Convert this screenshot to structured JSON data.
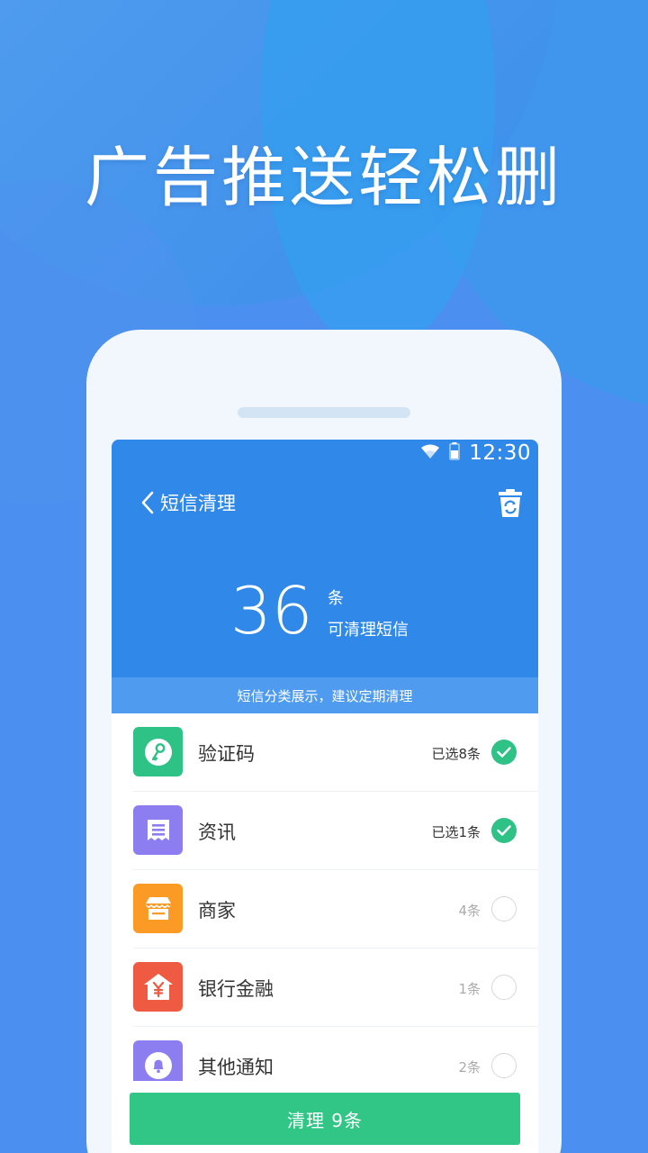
{
  "headline": "广告推送轻松删",
  "status": {
    "time": "12:30"
  },
  "appbar": {
    "title": "短信清理"
  },
  "summary": {
    "count": "36",
    "unit": "条",
    "subtitle": "可清理短信"
  },
  "tip": "短信分类展示，建议定期清理",
  "categories": [
    {
      "label": "验证码",
      "count": "已选8条",
      "selected": true,
      "icon": "key-icon",
      "color": "#2fc286"
    },
    {
      "label": "资讯",
      "count": "已选1条",
      "selected": true,
      "icon": "receipt-icon",
      "color": "#8c7ef0"
    },
    {
      "label": "商家",
      "count": "4条",
      "selected": false,
      "icon": "store-icon",
      "color": "#fb9b26"
    },
    {
      "label": "银行金融",
      "count": "1条",
      "selected": false,
      "icon": "bank-icon",
      "color": "#ef5b42"
    },
    {
      "label": "其他通知",
      "count": "2条",
      "selected": false,
      "icon": "bell-icon",
      "color": "#8c7ef0"
    }
  ],
  "action": {
    "clean_label": "清理 9条"
  },
  "colors": {
    "background": "#4b8ff0",
    "hero": "#3089e8",
    "accent_green": "#32c686"
  }
}
